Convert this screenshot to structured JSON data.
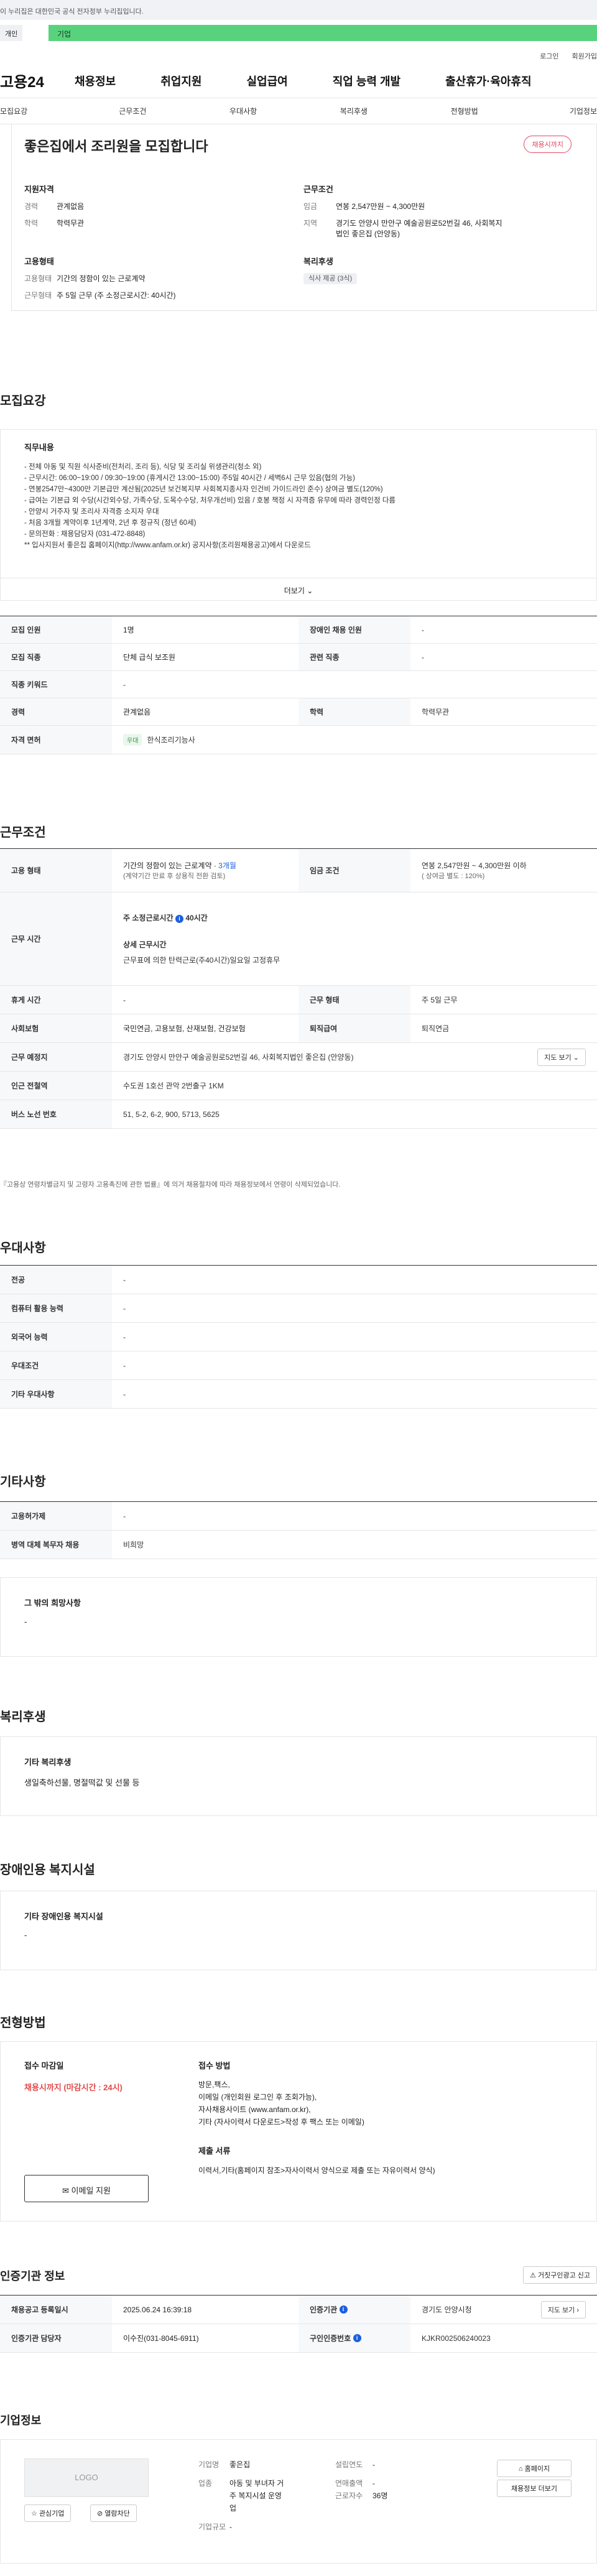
{
  "gov_banner": "이 누리집은 대한민국 공식 전자정부 누리집입니다.",
  "topbar": {
    "chip": "개인",
    "enterprise": "기업",
    "login": "로그인",
    "join": "회원가입"
  },
  "gnb": {
    "logo": "고용24",
    "menu": [
      "채용정보",
      "취업지원",
      "실업급여",
      "직업 능력 개발",
      "출산휴가·육아휴직"
    ]
  },
  "lnb": [
    "모집요강",
    "근무조건",
    "우대사항",
    "복리후생",
    "전형방법",
    "기업정보"
  ],
  "summary": {
    "title": "좋은집에서 조리원을 모집합니다",
    "badge": "채용시까지",
    "qual_h": "지원자격",
    "career_k": "경력",
    "career_v": "관계없음",
    "edu_k": "학력",
    "edu_v": "학력무관",
    "cond_h": "근무조건",
    "wage_k": "임금",
    "wage_v": "연봉 2,547만원 ~ 4,300만원",
    "area_k": "지역",
    "area_v1": "경기도 안양시 만안구 예술공원로52번길 46, 사회복지",
    "area_v2": "법인 좋은집 (안양동)",
    "emp_h": "고용형태",
    "emp_k": "고용형태",
    "emp_v": "기간의 정함이 있는 근로계약",
    "hours_k": "근무형태",
    "hours_v": "주 5일 근무 (주 소정근로시간: 40시간)",
    "welfare_h": "복리후생",
    "welfare_v": "식사 제공 (3식)"
  },
  "recruit": {
    "h": "모집요강",
    "duty_h": "직무내용",
    "lines": [
      "- 전체 아동 및 직원 식사준비(전처리, 조리 등), 식당 및 조리실 위생관리(청소 외)",
      "- 근무시간: 06:00~19:00 / 09:30~19:00 (휴게시간 13:00~15:00) 주5일 40시간 / 세벽6시 근무 있음(협의 가능)",
      "- 연봉2547만~4300만 기본급만 계산됨(2025년 보건복지부 사회복지종사자 인건비 가이드라인 준수) 상여금 별도(120%)",
      "- 급여는 기본급 외 수당(시간외수당, 가족수당, 도목수수당, 처우개선비) 있음 / 호봉 책정 시 자격증 유무에 따라 경력인정 다름",
      "- 안양시 거주자 및 조리사 자격증 소지자 우대",
      "- 처음 3개월 계약이후 1년계약, 2년 후 정규직 (정년 60세)",
      "- 문의전화 : 채용담당자 (031-472-8848)",
      "** 입사지원서 좋은집 홈페이지(http://www.anfam.or.kr) 공지사항(조리원채용공고)에서 다운로드"
    ],
    "more": "더보기",
    "rows": [
      {
        "k": "모집 인원",
        "v": "1명",
        "k2": "장애인 채용 인원",
        "v2": "-"
      },
      {
        "k": "모집 직종",
        "v": "단체 급식 보조원",
        "k2": "관련 직종",
        "v2": "-"
      },
      {
        "k": "직종 키워드",
        "v": "-"
      },
      {
        "k": "경력",
        "v": "관계없음",
        "k2": "학력",
        "v2": "학력무관"
      },
      {
        "k": "자격 면허",
        "tag": "우대",
        "v": "한식조리기능사"
      }
    ]
  },
  "work": {
    "h": "근무조건",
    "emp_k": "고용 형태",
    "emp_v": "기간의 정함이 있는 근로계약 · ",
    "emp_months": "3개월",
    "emp_note": "(계약기간 만료 후 상용직 전환 검토)",
    "wage_k": "임금 조건",
    "wage_v": "연봉 2,547만원 ~ 4,300만원 이하",
    "wage_note": "( 상여금 별도 : 120%)",
    "hours_k": "근무 시간",
    "hours_main": "주 소정근로시간",
    "hours_val": "40시간",
    "hours_detail_h": "상세 근무시간",
    "hours_detail": "근무표에 의한 탄력근로(주40시간)일요일 고정휴무",
    "rest_k": "휴게 시간",
    "rest_v": "-",
    "form_k": "근무 형태",
    "form_v": "주 5일 근무",
    "ins_k": "사회보험",
    "ins_v": "국민연금, 고용보험, 산재보험, 건강보험",
    "ret_k": "퇴직급여",
    "ret_v": "퇴직연금",
    "place_k": "근무 예정지",
    "place_v": "경기도 안양시 만안구 예술공원로52번길 46, 사회복지법인 좋은집 (안양동)",
    "map_btn": "지도 보기",
    "subway_k": "인근 전철역",
    "subway_v": "수도권 1호선 관악 2번출구 1KM",
    "bus_k": "버스 노선 번호",
    "bus_v": "51, 5-2, 6-2, 900, 5713, 5625",
    "notice": "『고용상 연령차별금지 및 고령자 고용촉진에 관한 법률』에 의거 채용절차에 따라 채용정보에서 연령이 삭제되었습니다."
  },
  "pref": {
    "h": "우대사항",
    "rows": [
      [
        "전공",
        "-"
      ],
      [
        "컴퓨터 활용 능력",
        "-"
      ],
      [
        "외국어 능력",
        "-"
      ],
      [
        "우대조건",
        "-"
      ],
      [
        "기타 우대사항",
        "-"
      ]
    ]
  },
  "other": {
    "h": "기타사항",
    "rows": [
      [
        "고용허가제",
        "-"
      ],
      [
        "병역 대체 복무자 채용",
        "비희망"
      ]
    ],
    "etc_h": "그 밖의 희망사항",
    "etc_v": "-"
  },
  "welfare": {
    "h": "복리후생",
    "sub": "기타 복리후생",
    "v": "생일축하선물, 명절떡값 및 선물 등"
  },
  "disabled": {
    "h": "장애인용 복지시설",
    "sub": "기타 장애인용 복지시설",
    "v": "-"
  },
  "apply": {
    "h": "전형방법",
    "deadline_h": "접수 마감일",
    "deadline_v": "채용시까지 (마감시간 : 24시)",
    "method_h": "접수 방법",
    "methods": [
      "방문,팩스,",
      "이메일 (개인회원 로그인 후 조회가능),",
      "자사채용사이트 (www.anfam.or.kr),",
      "기타 (자사이력서 다운로드>작성 후 팩스 또는 이메일)"
    ],
    "docs_h": "제출 서류",
    "docs_v": "이력서,기타(홈페이지 참조>자사이력서 양식으로 제출 또는 자유이력서 양식)",
    "email_btn": "이메일 지원"
  },
  "cert": {
    "h": "인증기관 정보",
    "report_btn": "거짓구인광고 신고",
    "reg_k": "채용공고 등록일시",
    "reg_v": "2025.06.24 16:39:18",
    "org_k": "인증기관",
    "org_v": "경기도 안양시청",
    "map_btn": "지도 보기",
    "mgr_k": "인증기관 담당자",
    "mgr_v": "이수진(031-8045-6911)",
    "no_k": "구인인증번호",
    "no_v": "KJKR002506240023"
  },
  "company": {
    "h": "기업정보",
    "logo": "LOGO",
    "fav": "관심기업",
    "block": "열람차단",
    "name_k": "기업명",
    "name_v": "좋은집",
    "est_k": "설립연도",
    "est_v": "-",
    "biz_k": "업종",
    "biz_v1": "아동 및 부녀자 거",
    "biz_v2": "주 복지시설 운영",
    "biz_v3": "업",
    "sales_k": "연매출액",
    "sales_v": "-",
    "emp_k": "근로자수",
    "emp_v": "36명",
    "size_k": "기업규모",
    "size_v": "-",
    "home_btn": "홈페이지",
    "jobs_btn": "채용정보 더보기"
  }
}
